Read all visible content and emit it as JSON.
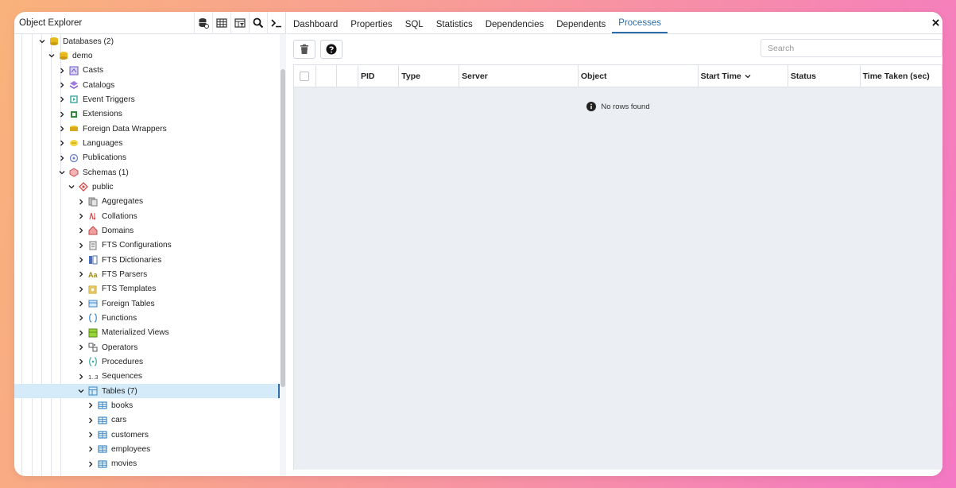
{
  "object_explorer": {
    "title": "Object Explorer",
    "tools": [
      "database-icon",
      "table-icon",
      "table-search-icon",
      "search-icon",
      "terminal-icon"
    ]
  },
  "tree": [
    {
      "label": "Databases (2)",
      "level": 1,
      "expanded": true,
      "icon": "databases-icon"
    },
    {
      "label": "demo",
      "level": 2,
      "expanded": true,
      "icon": "database-icon"
    },
    {
      "label": "Casts",
      "level": 3,
      "expanded": false,
      "icon": "casts-icon"
    },
    {
      "label": "Catalogs",
      "level": 3,
      "expanded": false,
      "icon": "catalogs-icon"
    },
    {
      "label": "Event Triggers",
      "level": 3,
      "expanded": false,
      "icon": "event-triggers-icon"
    },
    {
      "label": "Extensions",
      "level": 3,
      "expanded": false,
      "icon": "extensions-icon"
    },
    {
      "label": "Foreign Data Wrappers",
      "level": 3,
      "expanded": false,
      "icon": "foreign-data-wrappers-icon"
    },
    {
      "label": "Languages",
      "level": 3,
      "expanded": false,
      "icon": "languages-icon"
    },
    {
      "label": "Publications",
      "level": 3,
      "expanded": false,
      "icon": "publications-icon"
    },
    {
      "label": "Schemas (1)",
      "level": 3,
      "expanded": true,
      "icon": "schemas-icon"
    },
    {
      "label": "public",
      "level": 4,
      "expanded": true,
      "icon": "schema-icon"
    },
    {
      "label": "Aggregates",
      "level": 5,
      "expanded": false,
      "icon": "aggregates-icon"
    },
    {
      "label": "Collations",
      "level": 5,
      "expanded": false,
      "icon": "collations-icon"
    },
    {
      "label": "Domains",
      "level": 5,
      "expanded": false,
      "icon": "domains-icon"
    },
    {
      "label": "FTS Configurations",
      "level": 5,
      "expanded": false,
      "icon": "fts-configurations-icon"
    },
    {
      "label": "FTS Dictionaries",
      "level": 5,
      "expanded": false,
      "icon": "fts-dictionaries-icon"
    },
    {
      "label": "FTS Parsers",
      "level": 5,
      "expanded": false,
      "icon": "fts-parsers-icon"
    },
    {
      "label": "FTS Templates",
      "level": 5,
      "expanded": false,
      "icon": "fts-templates-icon"
    },
    {
      "label": "Foreign Tables",
      "level": 5,
      "expanded": false,
      "icon": "foreign-tables-icon"
    },
    {
      "label": "Functions",
      "level": 5,
      "expanded": false,
      "icon": "functions-icon"
    },
    {
      "label": "Materialized Views",
      "level": 5,
      "expanded": false,
      "icon": "materialized-views-icon"
    },
    {
      "label": "Operators",
      "level": 5,
      "expanded": false,
      "icon": "operators-icon"
    },
    {
      "label": "Procedures",
      "level": 5,
      "expanded": false,
      "icon": "procedures-icon"
    },
    {
      "label": "Sequences",
      "level": 5,
      "expanded": false,
      "icon": "sequences-icon"
    },
    {
      "label": "Tables (7)",
      "level": 5,
      "expanded": true,
      "selected": true,
      "icon": "tables-icon"
    },
    {
      "label": "books",
      "level": 6,
      "expanded": false,
      "icon": "table-icon"
    },
    {
      "label": "cars",
      "level": 6,
      "expanded": false,
      "icon": "table-icon"
    },
    {
      "label": "customers",
      "level": 6,
      "expanded": false,
      "icon": "table-icon"
    },
    {
      "label": "employees",
      "level": 6,
      "expanded": false,
      "icon": "table-icon"
    },
    {
      "label": "movies",
      "level": 6,
      "expanded": false,
      "icon": "table-icon"
    }
  ],
  "tabs": [
    {
      "label": "Dashboard",
      "active": false
    },
    {
      "label": "Properties",
      "active": false
    },
    {
      "label": "SQL",
      "active": false
    },
    {
      "label": "Statistics",
      "active": false
    },
    {
      "label": "Dependencies",
      "active": false
    },
    {
      "label": "Dependents",
      "active": false
    },
    {
      "label": "Processes",
      "active": true
    }
  ],
  "toolbar": {
    "delete_icon": "trash-icon",
    "help_icon": "help-icon"
  },
  "search": {
    "placeholder": "Search"
  },
  "table": {
    "columns": [
      "",
      "",
      "",
      "PID",
      "Type",
      "Server",
      "Object",
      "Start Time",
      "Status",
      "Time Taken (sec)"
    ],
    "sorted_column": "Start Time",
    "empty_message": "No rows found"
  },
  "colors": {
    "accent": "#2d6ea8",
    "selected_row": "#d6ebf9",
    "grid_bg": "#ebeef3"
  }
}
